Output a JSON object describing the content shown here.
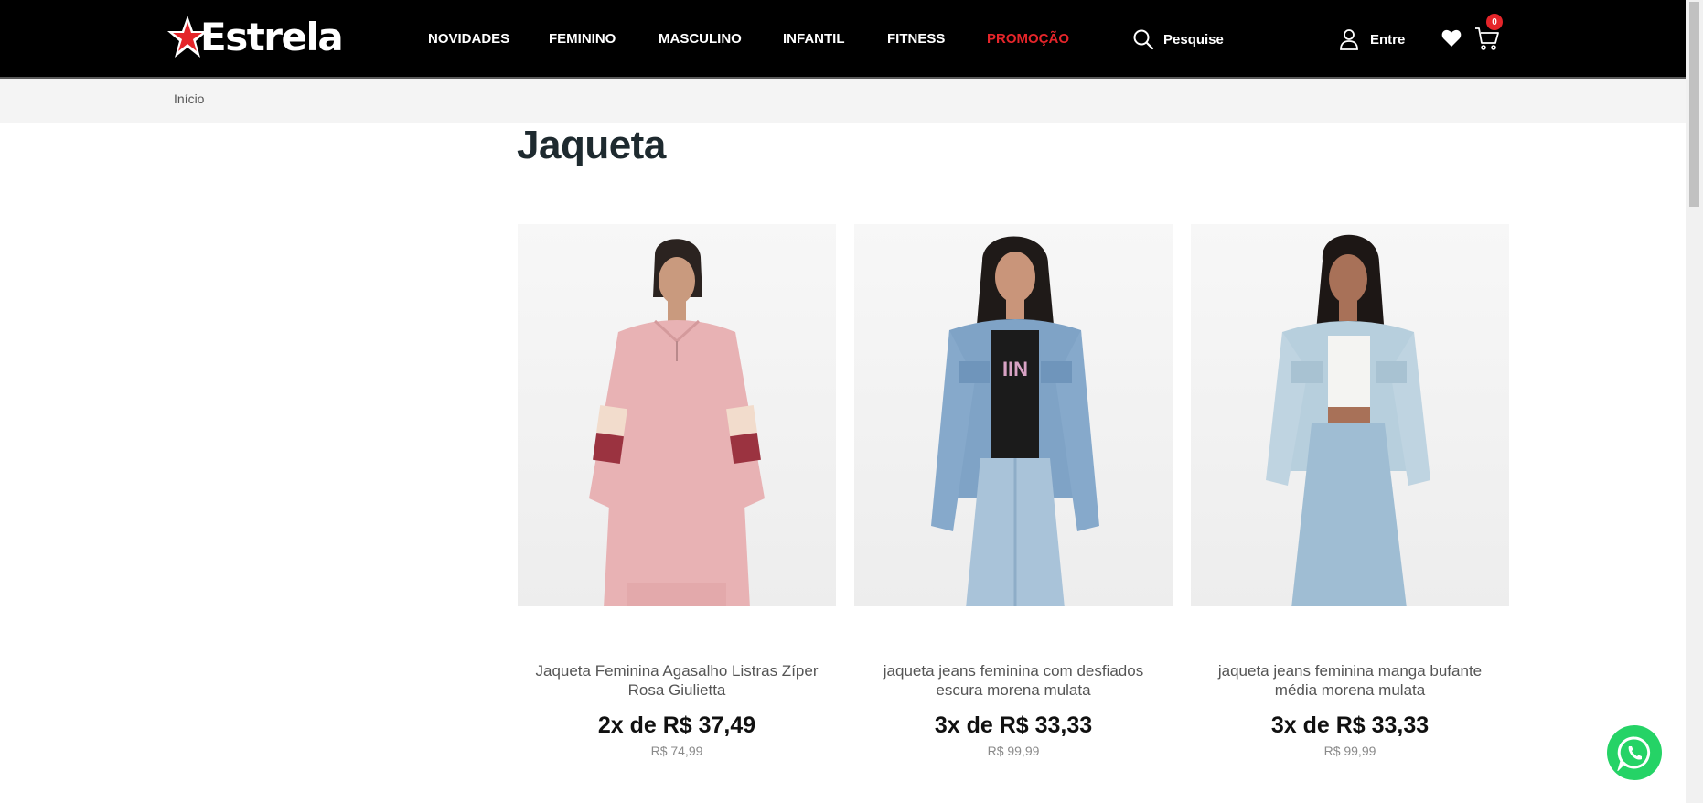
{
  "header": {
    "brand": "Estrela",
    "nav": [
      {
        "label": "NOVIDADES"
      },
      {
        "label": "FEMININO"
      },
      {
        "label": "MASCULINO"
      },
      {
        "label": "INFANTIL"
      },
      {
        "label": "FITNESS"
      },
      {
        "label": "PROMOÇÃO",
        "highlight": true
      }
    ],
    "search_label": "Pesquise",
    "account_label": "Entre",
    "cart_count": "0",
    "icons": [
      "search-icon",
      "user-icon",
      "heart-icon",
      "cart-icon"
    ],
    "promo_color": "#e5252a",
    "background_color": "#000000"
  },
  "breadcrumb": {
    "home": "Início"
  },
  "page_title": "Jaqueta",
  "products": [
    {
      "name": "Jaqueta Feminina Agasalho Listras Zíper Rosa Giulietta",
      "installments": "2x de R$ 37,49",
      "price": "R$ 74,99"
    },
    {
      "name": "jaqueta jeans feminina com desfiados escura morena mulata",
      "installments": "3x de R$ 33,33",
      "price": "R$ 99,99"
    },
    {
      "name": "jaqueta jeans feminina manga bufante média morena mulata",
      "installments": "3x de R$ 33,33",
      "price": "R$ 99,99"
    }
  ],
  "floating": {
    "icon": "whatsapp-icon",
    "color": "#25d366"
  }
}
